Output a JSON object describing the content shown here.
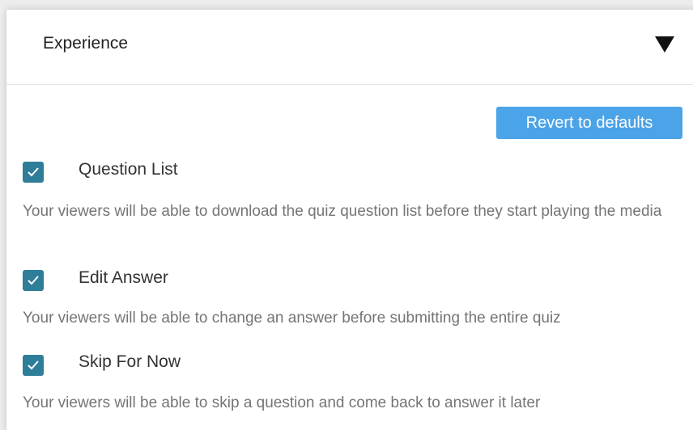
{
  "section": {
    "title": "Experience"
  },
  "revert_button": {
    "label": "Revert to defaults"
  },
  "options": [
    {
      "label": "Question List",
      "checked": true,
      "description": "Your viewers will be able to download the quiz question list before they start playing the media"
    },
    {
      "label": "Edit Answer",
      "checked": true,
      "description": "Your viewers will be able to change an answer before submitting the entire quiz"
    },
    {
      "label": "Skip For Now",
      "checked": true,
      "description": "Your viewers will be able to skip a question and come back to answer it later"
    }
  ],
  "colors": {
    "accent_button": "#4ba4e8",
    "checkbox": "#2e7d99",
    "description_text": "#757575"
  },
  "icons": {
    "collapse": "caret-down-icon",
    "check": "checkmark-icon"
  }
}
